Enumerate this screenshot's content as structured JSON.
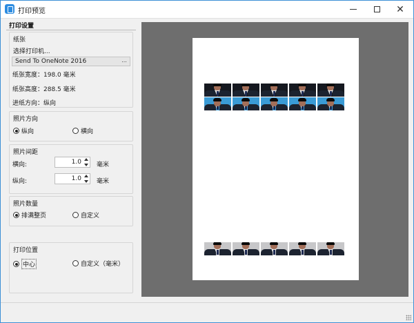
{
  "window": {
    "title": "打印预览",
    "controls": {
      "minimize": "minimize",
      "maximize": "maximize",
      "close": "✕"
    }
  },
  "panel": {
    "header": "打印设置",
    "paper": {
      "group_title": "纸张",
      "select_printer": "选择打印机...",
      "printer_value": "Send To OneNote 2016",
      "browse_label": "...",
      "width_label": "纸张宽度：198.0 毫米",
      "height_label": "纸张高度：288.5 毫米",
      "feed_label": "进纸方向：纵向"
    },
    "orientation": {
      "group_title": "照片方向",
      "options": [
        {
          "label": "纵向",
          "checked": true
        },
        {
          "label": "横向",
          "checked": false
        }
      ]
    },
    "spacing": {
      "group_title": "照片间距",
      "rows": [
        {
          "label": "横向:",
          "value": "1.0",
          "unit": "毫米"
        },
        {
          "label": "纵向:",
          "value": "1.0",
          "unit": "毫米"
        }
      ]
    },
    "quantity": {
      "group_title": "照片数量",
      "options": [
        {
          "label": "排满整页",
          "checked": true
        },
        {
          "label": "自定义",
          "checked": false
        }
      ]
    },
    "position": {
      "group_title": "打印位置",
      "options": [
        {
          "label": "中心",
          "checked": true
        },
        {
          "label": "自定义（毫米）",
          "checked": false
        }
      ]
    }
  },
  "preview": {
    "background": "#6e6e6e",
    "page_background": "#ffffff",
    "photo_rows": [
      {
        "style": "dark",
        "count": 5
      },
      {
        "style": "blue",
        "count": 5
      },
      {
        "style": "light",
        "count": 5
      }
    ]
  },
  "colors": {
    "window_border": "#3c8fd6",
    "photo_blue_bg": "#3a9bd6",
    "photo_dark_bg": "#15181f"
  }
}
